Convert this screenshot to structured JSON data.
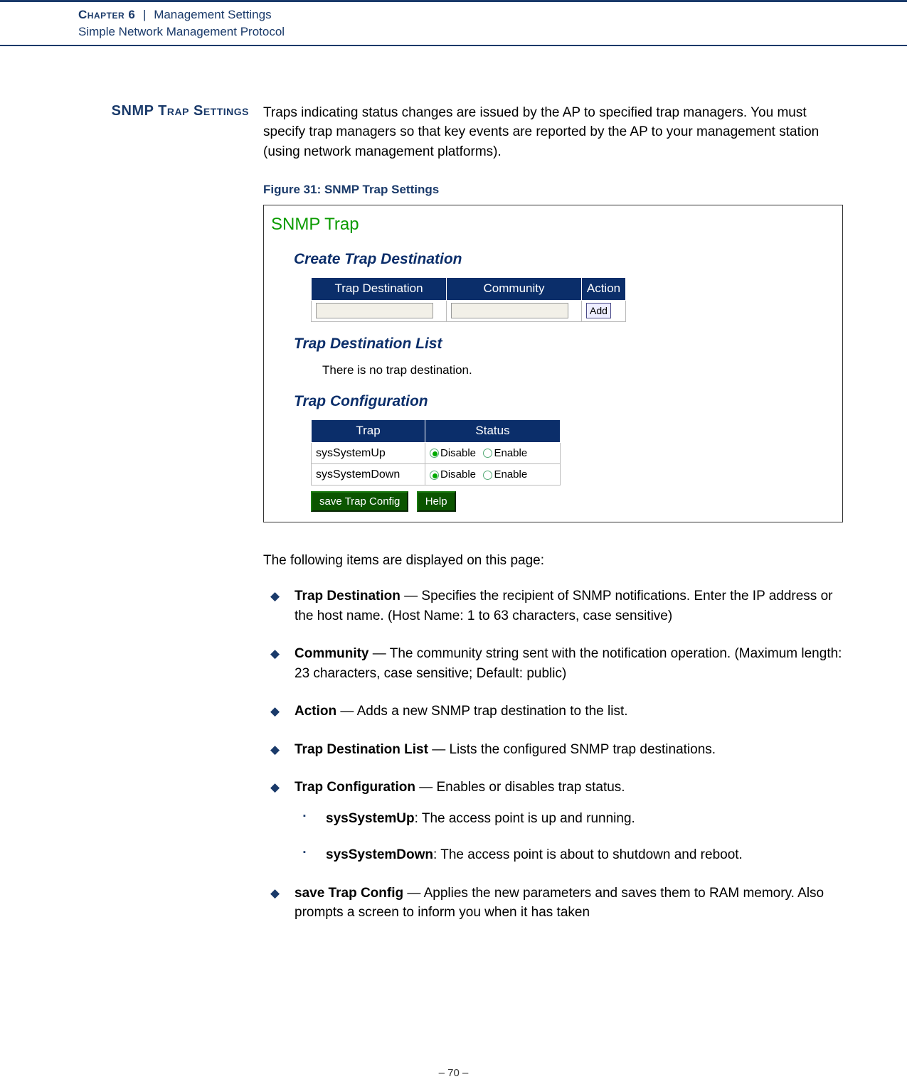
{
  "header": {
    "chapter": "Chapter 6",
    "pipe": "|",
    "title": "Management Settings",
    "subtitle": "Simple Network Management Protocol"
  },
  "side_heading": "SNMP Trap Settings",
  "intro": "Traps indicating status changes are issued by the AP to specified trap managers. You must specify trap managers so that key events are reported by the AP to your management station (using network management platforms).",
  "figure_caption": "Figure 31:  SNMP Trap Settings",
  "figure": {
    "title": "SNMP Trap",
    "create_heading": "Create Trap Destination",
    "cols": {
      "dest": "Trap Destination",
      "comm": "Community",
      "action": "Action"
    },
    "add_label": "Add",
    "dest_list_heading": "Trap Destination List",
    "empty_msg": "There is no trap destination.",
    "config_heading": "Trap Configuration",
    "config_cols": {
      "trap": "Trap",
      "status": "Status"
    },
    "rows": [
      {
        "name": "sysSystemUp",
        "disable": "Disable",
        "enable": "Enable"
      },
      {
        "name": "sysSystemDown",
        "disable": "Disable",
        "enable": "Enable"
      }
    ],
    "save_btn": "save Trap Config",
    "help_btn": "Help"
  },
  "items_lead": "The following items are displayed on this page:",
  "bullets": {
    "b1_term": "Trap Destination",
    "b1_text": " — Specifies the recipient of SNMP notifications. Enter the IP address or the host name. (Host Name: 1 to 63 characters, case sensitive)",
    "b2_term": "Community",
    "b2_text": " — The community string sent with the notification operation. (Maximum length: 23 characters, case sensitive; Default: public)",
    "b3_term": "Action",
    "b3_text": " — Adds a new SNMP trap destination to the list.",
    "b4_term": "Trap Destination List",
    "b4_text": " — Lists the configured SNMP trap destinations.",
    "b5_term": "Trap Configuration",
    "b5_text": " — Enables or disables trap status.",
    "s1_term": "sysSystemUp",
    "s1_text": ": The access point is up and running.",
    "s2_term": "sysSystemDown",
    "s2_text": ": The access point is about to shutdown and reboot.",
    "b6_term": "save Trap Config",
    "b6_text": " — Applies the new parameters and saves them to RAM memory. Also prompts a screen to inform you when it has taken"
  },
  "page_number": "–  70  –"
}
